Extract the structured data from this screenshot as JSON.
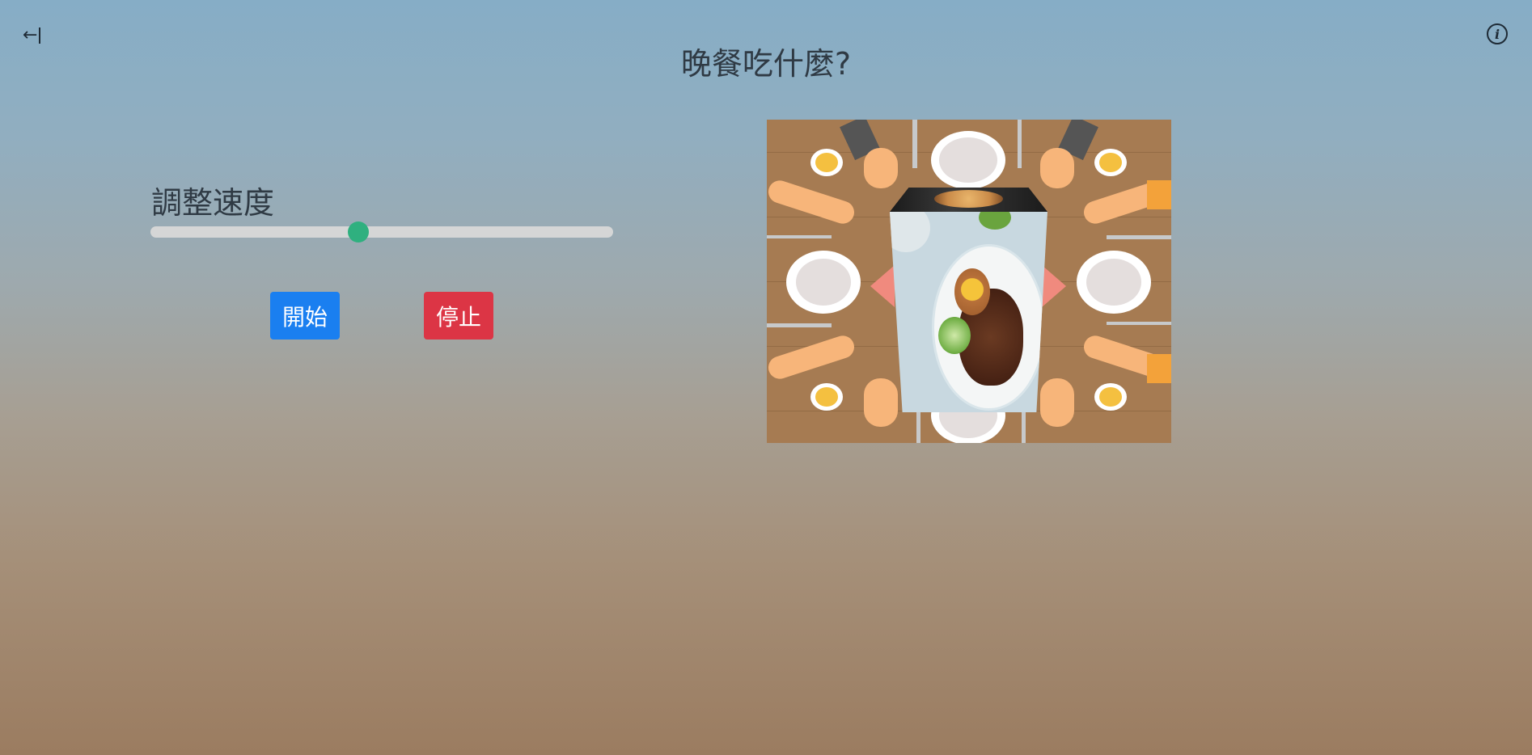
{
  "header": {
    "title": "晚餐吃什麼?",
    "back_icon": "back-to-start-icon",
    "info_icon": "info-icon",
    "back_glyph": "←",
    "info_glyph": "i"
  },
  "controls": {
    "speed_label": "調整速度",
    "speed_value_fraction": 0.45,
    "start_label": "開始",
    "stop_label": "停止",
    "start_color": "#1a7ff0",
    "stop_color": "#dc3545",
    "slider_thumb_color": "#2fb07f"
  },
  "scene": {
    "description_icon": "dinner-table-illustration",
    "cube_face": "braised-pork-rice-photo"
  }
}
